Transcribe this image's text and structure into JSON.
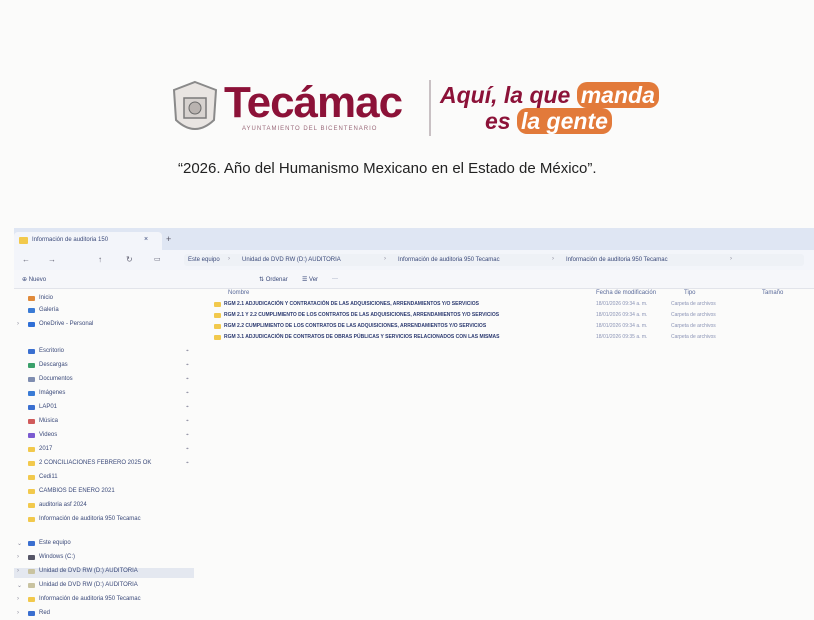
{
  "letterhead": {
    "brand": "Tecámac",
    "brand_sub": "AYUNTAMIENTO DEL BICENTENARIO",
    "slogan_line1_a": "Aquí, la que ",
    "slogan_line1_b": "manda",
    "slogan_line2_a": "es ",
    "slogan_line2_b": "la gente",
    "motto": "“2026. Año del Humanismo Mexicano en el Estado de México”."
  },
  "explorer": {
    "tab_title": "Información de auditoria 150",
    "tab_close": "×",
    "tab_new": "+",
    "nav": {
      "back": "←",
      "forward": "→",
      "up": "↑",
      "refresh": "↻"
    },
    "breadcrumbs": [
      "Este equipo",
      "Unidad de DVD RW (D:) AUDITORIA",
      "Información de auditoria 950 Tecamac",
      "Información de auditoria 950 Tecamac"
    ],
    "breadcrumb_sep": "›",
    "commands": {
      "new": "Nuevo",
      "sort": "Ordenar",
      "view": "Ver",
      "more": "···"
    },
    "sidebar": [
      {
        "label": "Inicio",
        "color": "#e08a3a"
      },
      {
        "label": "Galería",
        "color": "#3a7bd5"
      },
      {
        "label": "OneDrive - Personal",
        "color": "#2f6fd6",
        "chev": "›"
      },
      {
        "label": "Escritorio",
        "color": "#3a6fd0",
        "pin": "⌖"
      },
      {
        "label": "Descargas",
        "color": "#3aa06a",
        "pin": "⌖"
      },
      {
        "label": "Documentos",
        "color": "#7f8db0",
        "pin": "⌖"
      },
      {
        "label": "Imágenes",
        "color": "#3a7bd5",
        "pin": "⌖"
      },
      {
        "label": "LAP01",
        "color": "#3a6fd0",
        "pin": "⌖"
      },
      {
        "label": "Música",
        "color": "#d05a5a",
        "pin": "⌖"
      },
      {
        "label": "Videos",
        "color": "#7a5ad0",
        "pin": "⌖"
      },
      {
        "label": "2017",
        "color": "#f2c94c",
        "pin": "⌖"
      },
      {
        "label": "2 CONCILIACIONES FEBRERO 2025 OK",
        "color": "#f2c94c",
        "pin": "⌖"
      },
      {
        "label": "Cedi11",
        "color": "#f2c94c"
      },
      {
        "label": "CAMBIOS DE ENERO 2021",
        "color": "#f2c94c"
      },
      {
        "label": "auditoria asf 2024",
        "color": "#f2c94c"
      },
      {
        "label": "Información de auditoria 950 Tecamac",
        "color": "#f2c94c"
      },
      {
        "label": "Este equipo",
        "color": "#3a6fd0",
        "chev": "⌄"
      },
      {
        "label": "Windows (C:)",
        "color": "#556",
        "chev": "›"
      },
      {
        "label": "Unidad de DVD RW (D:) AUDITORIA",
        "color": "#c9c3a0",
        "chev": "›",
        "selected": true
      },
      {
        "label": "Unidad de DVD RW (D:) AUDITORIA",
        "color": "#c9c3a0",
        "chev": "⌄"
      },
      {
        "label": "Información de auditoria 950 Tecamac",
        "color": "#f2c94c",
        "chev": "›"
      },
      {
        "label": "Red",
        "color": "#3a6fd0",
        "chev": "›"
      }
    ],
    "columns": {
      "name": "Nombre",
      "date": "Fecha de modificación",
      "type": "Tipo",
      "size": "Tamaño"
    },
    "files": [
      {
        "name": "RGM 2.1 ADJUDICACIÓN Y CONTRATACIÓN DE LAS ADQUISICIONES, ARRENDAMIENTOS Y/O SERVICIOS",
        "date": "18/01/2026 09:34 a. m.",
        "type": "Carpeta de archivos"
      },
      {
        "name": "RGM 2.1 Y 2.2 CUMPLIMIENTO DE LOS CONTRATOS DE LAS ADQUISICIONES, ARRENDAMIENTOS Y/O SERVICIOS",
        "date": "18/01/2026 09:34 a. m.",
        "type": "Carpeta de archivos"
      },
      {
        "name": "RGM 2.2 CUMPLIMIENTO DE LOS CONTRATOS DE LAS ADQUISICIONES, ARRENDAMIENTOS Y/O SERVICIOS",
        "date": "18/01/2026 09:34 a. m.",
        "type": "Carpeta de archivos"
      },
      {
        "name": "RGM 3.1 ADJUDICACIÓN DE CONTRATOS DE OBRAS PÚBLICAS Y SERVICIOS RELACIONADOS CON LAS MISMAS",
        "date": "18/01/2026 09:35 a. m.",
        "type": "Carpeta de archivos"
      }
    ]
  }
}
